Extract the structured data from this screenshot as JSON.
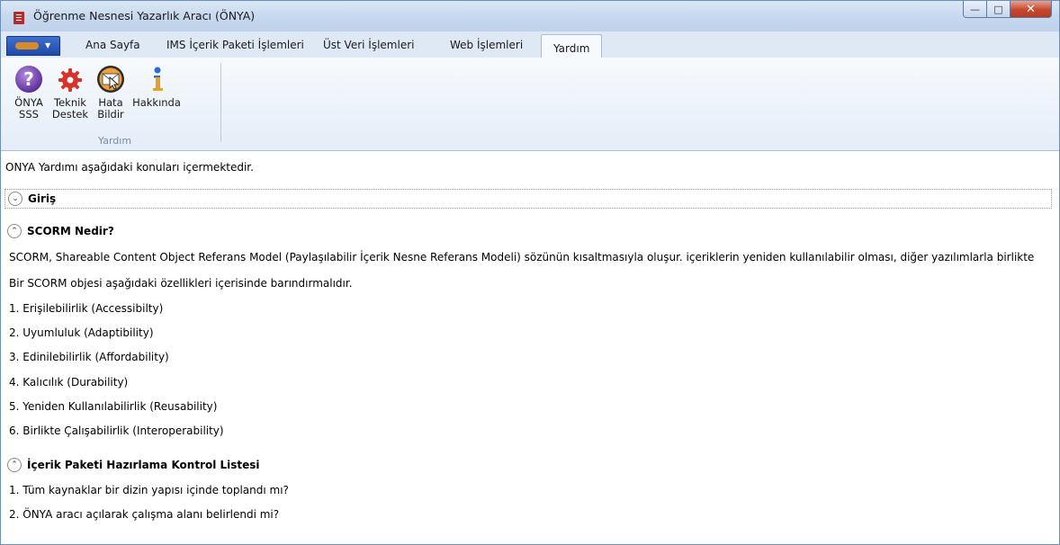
{
  "window": {
    "title": "Öğrenme Nesnesi Yazarlık Aracı (ÖNYA)"
  },
  "tabs": [
    {
      "label": "Ana Sayfa"
    },
    {
      "label": "IMS İçerik Paketi İşlemleri"
    },
    {
      "label": "Üst Veri İşlemleri"
    },
    {
      "label": "Web İşlemleri"
    },
    {
      "label": "Yardım"
    }
  ],
  "ribbon": {
    "buttons": [
      {
        "line1": "ÖNYA",
        "line2": "SSS",
        "icon": "help-question-icon"
      },
      {
        "line1": "Teknik",
        "line2": "Destek",
        "icon": "gear-support-icon"
      },
      {
        "line1": "Hata",
        "line2": "Bildir",
        "icon": "mail-report-icon"
      },
      {
        "line1": "Hakkında",
        "line2": "",
        "icon": "info-icon"
      }
    ],
    "group_label": "Yardım"
  },
  "content": {
    "intro": "ONYA Yardımı aşağıdaki konuları içermektedir.",
    "sections": [
      {
        "title": "Giriş",
        "expanded": false
      },
      {
        "title": "SCORM Nedir?",
        "expanded": true,
        "lines": [
          "SCORM, Shareable Content Object Referans Model (Paylaşılabilir İçerik Nesne Referans Modeli) sözünün kısaltmasıyla oluşur. içeriklerin yeniden kullanılabilir olması, diğer yazılımlarla birlikte",
          "Bir SCORM objesi aşağıdaki özellikleri içerisinde barındırmalıdır.",
          "1. Erişilebilirlik (Accessibilty)",
          "2. Uyumluluk (Adaptibility)",
          "3. Edinilebilirlik (Affordability)",
          "4. Kalıcılık (Durability)",
          "5. Yeniden Kullanılabilirlik (Reusability)",
          "6. Birlikte Çalışabilirlik (Interoperability)"
        ]
      },
      {
        "title": "İçerik Paketi Hazırlama Kontrol Listesi",
        "expanded": true,
        "lines": [
          "1. Tüm kaynaklar bir dizin yapısı içinde toplandı mı?",
          "2. ÖNYA aracı açılarak çalışma alanı belirlendi mi?"
        ]
      }
    ]
  },
  "colors": {
    "accent_blue": "#2452b0",
    "close_red": "#c6482e",
    "ribbon_bg": "#e4edf8"
  }
}
